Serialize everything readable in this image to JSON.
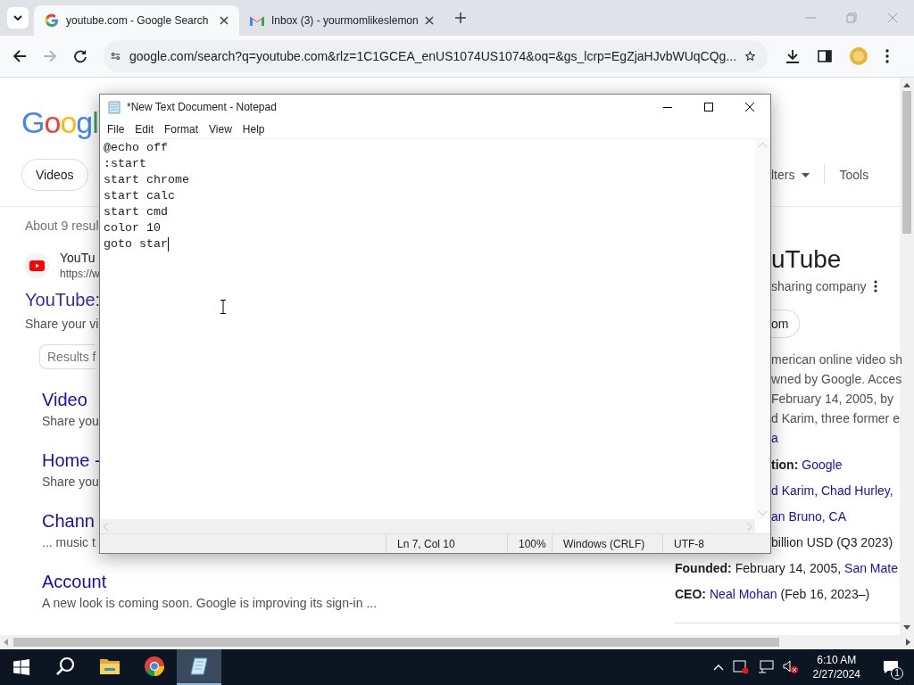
{
  "browser": {
    "tabs": [
      {
        "title": "youtube.com - Google Search",
        "selected": true,
        "kind": "google"
      },
      {
        "title": "Inbox (3) - yourmomlikeslemon",
        "selected": false,
        "kind": "mail"
      }
    ],
    "url": "google.com/search?q=youtube.com&rlz=1C1GCEA_enUS1074US1074&oq=&gs_lcrp=EgZjaHJvbWUqCQg..."
  },
  "page": {
    "logo": "Googl",
    "chips": [
      "Videos"
    ],
    "filters": "lters",
    "tools": "Tools",
    "stats": "About 9 resul",
    "result": {
      "site": "YouTu",
      "url": "https://w",
      "title": "YouTube:",
      "snippet": "Share your vi",
      "button": "Results f"
    },
    "sitelinks": [
      {
        "title": "Video",
        "snippet": "Share you"
      },
      {
        "title": "Home -",
        "snippet": "Share you"
      },
      {
        "title": "Chann",
        "snippet": "... music t"
      },
      {
        "title": "Account",
        "snippet": "A new look is coming soon. Google is improving its sign-in ..."
      }
    ],
    "panel": {
      "title": "uTube",
      "subtitle": "sharing company",
      "chip": "om",
      "description": [
        "merican online video sh",
        "wned by Google. Acces",
        "February 14, 2005, by",
        "d Karim, three former e"
      ],
      "source": "a",
      "facts": [
        {
          "label": "tion:",
          "link": "Google"
        },
        {
          "link": "d Karim, Chad Hurley,"
        },
        {
          "link": "an Bruno, CA"
        },
        {
          "value": "billion USD (Q3 2023)"
        },
        {
          "label": "Founded:",
          "value": "February 14, 2005,",
          "link": "San Mate"
        },
        {
          "label": "CEO:",
          "link": "Neal Mohan",
          "rest": "(Feb 16, 2023–)"
        }
      ]
    }
  },
  "notepad": {
    "title": "*New Text Document - Notepad",
    "menu": [
      "File",
      "Edit",
      "Format",
      "View",
      "Help"
    ],
    "lines": [
      "@echo off",
      ":start",
      "start chrome",
      "start calc",
      "start cmd",
      "color 10",
      "goto star"
    ],
    "status": [
      "Ln 7, Col 10",
      "100%",
      "Windows (CRLF)",
      "UTF-8"
    ]
  },
  "taskbar": {
    "apps": [
      {
        "kind": "search",
        "selected": false
      },
      {
        "kind": "folder",
        "selected": false
      },
      {
        "kind": "chrome",
        "selected": false
      },
      {
        "kind": "notepad",
        "selected": true
      }
    ],
    "time": "6:10 AM",
    "date": "2/27/2024",
    "notifications": "1"
  }
}
